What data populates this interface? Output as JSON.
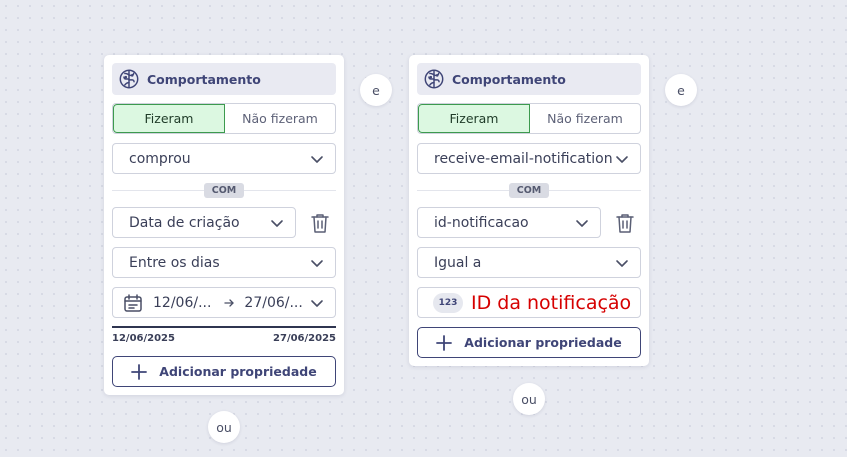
{
  "connectors": {
    "and_label": "e",
    "or_label": "ou"
  },
  "card1": {
    "header": {
      "icon": "brain-icon",
      "title": "Comportamento"
    },
    "tabs": {
      "did": "Fizeram",
      "did_not": "Não fizeram",
      "active": "did"
    },
    "event_select": "comprou",
    "with_label": "COM",
    "property_select": "Data de criação",
    "operator_select": "Entre os dias",
    "date_range": {
      "start": "12/06/...",
      "end": "27/06/..."
    },
    "range_labels": {
      "start": "12/06/2025",
      "end": "27/06/2025"
    },
    "add_property": "Adicionar propriedade"
  },
  "card2": {
    "header": {
      "icon": "brain-icon",
      "title": "Comportamento"
    },
    "tabs": {
      "did": "Fizeram",
      "did_not": "Não fizeram",
      "active": "did"
    },
    "event_select": "receive-email-notification",
    "with_label": "COM",
    "property_select": "id-notificacao",
    "operator_select": "Igual a",
    "value_type_chip": "123",
    "value_placeholder": "ID da notificação",
    "add_property": "Adicionar propriedade"
  },
  "colors": {
    "accent": "#3f4577",
    "active_tab_bg": "#dcf8e1",
    "active_tab_border": "#3c9a4e",
    "placeholder_red": "#d60000"
  }
}
